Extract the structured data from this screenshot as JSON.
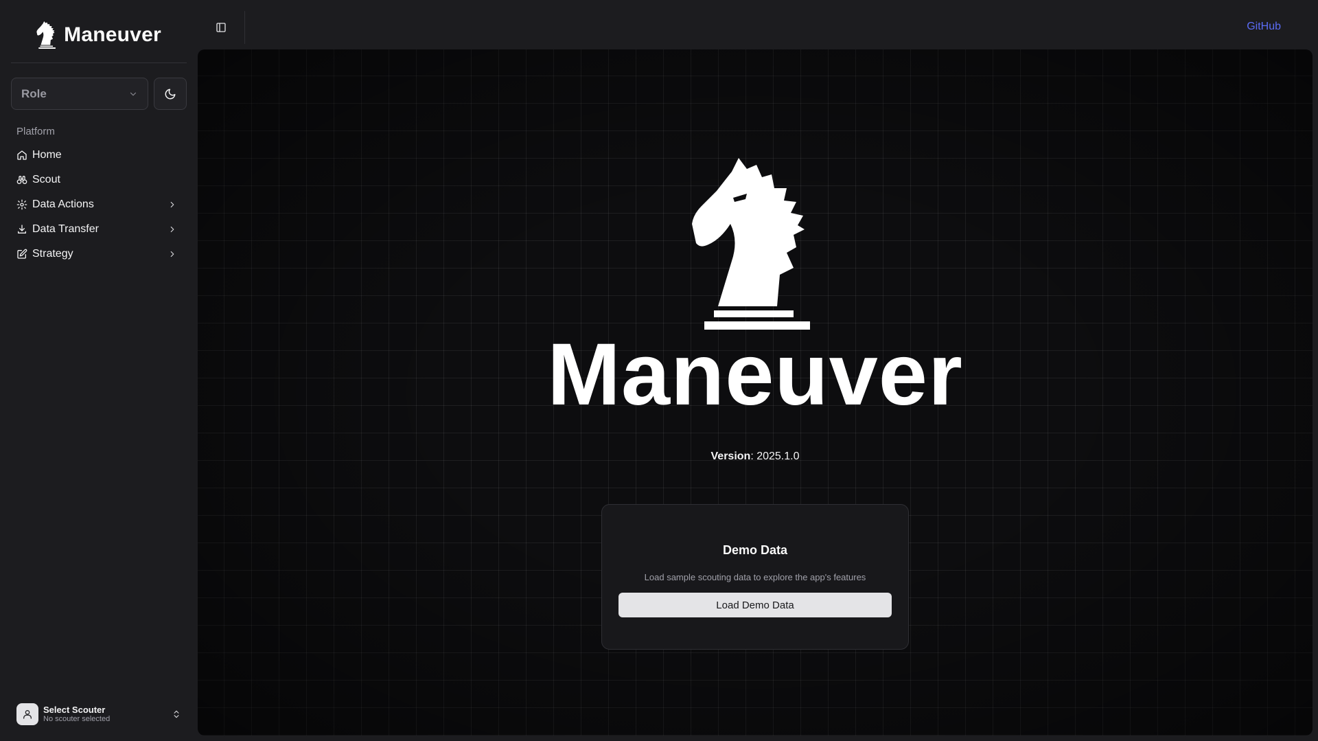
{
  "brand": {
    "name": "Maneuver"
  },
  "sidebar": {
    "role_select": {
      "value": "Role"
    },
    "section_label": "Platform",
    "items": [
      {
        "label": "Home",
        "icon": "home-icon",
        "has_submenu": false
      },
      {
        "label": "Scout",
        "icon": "binoculars-icon",
        "has_submenu": false
      },
      {
        "label": "Data Actions",
        "icon": "gear-icon",
        "has_submenu": true
      },
      {
        "label": "Data Transfer",
        "icon": "download-icon",
        "has_submenu": true
      },
      {
        "label": "Strategy",
        "icon": "edit-icon",
        "has_submenu": true
      }
    ],
    "scouter": {
      "title": "Select Scouter",
      "subtitle": "No scouter selected"
    }
  },
  "topbar": {
    "github_label": "GitHub"
  },
  "main": {
    "title": "Maneuver",
    "version_label": "Version",
    "version_value": ": 2025.1.0",
    "demo_card": {
      "title": "Demo Data",
      "description": "Load sample scouting data to explore the app's features",
      "button_label": "Load Demo Data"
    }
  },
  "colors": {
    "link": "#5b6cf5",
    "sidebar_bg": "#1c1c1f",
    "main_bg": "#0d0d0f",
    "button_bg": "#e4e4e7"
  }
}
